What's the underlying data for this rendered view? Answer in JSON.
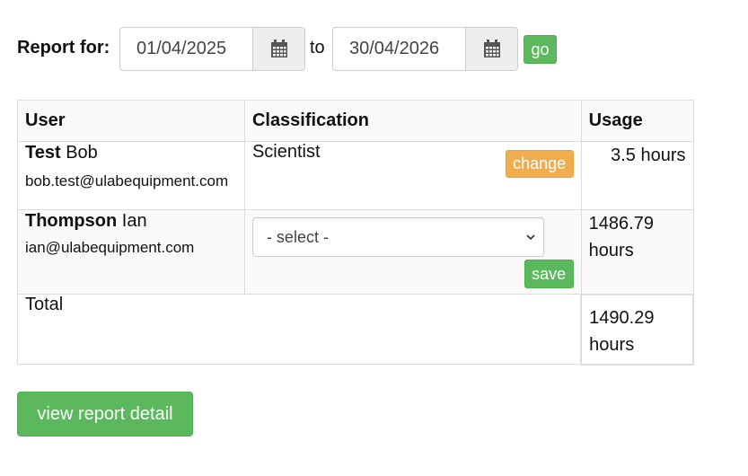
{
  "report": {
    "label": "Report for:",
    "from_date": "01/04/2025",
    "to_label": "to",
    "to_date": "30/04/2026",
    "go_label": "go"
  },
  "table": {
    "headers": {
      "user": "User",
      "classification": "Classification",
      "usage": "Usage"
    },
    "rows": [
      {
        "surname": "Test",
        "forename": "Bob",
        "email": "bob.test@ulabequipment.com",
        "classification": "Scientist",
        "action_label": "change",
        "usage": "3.5 hours"
      },
      {
        "surname": "Thompson",
        "forename": "Ian",
        "email": "ian@ulabequipment.com",
        "select_value": "- select -",
        "action_label": "save",
        "usage": "1486.79 hours"
      }
    ],
    "total_label": "Total",
    "total_usage": "1490.29 hours"
  },
  "actions": {
    "view_detail": "view report detail"
  },
  "colors": {
    "success": "#5cb85c",
    "warning": "#f0ad4e"
  },
  "icons": {
    "calendar": "calendar-icon",
    "chevron": "chevron-down-icon"
  }
}
